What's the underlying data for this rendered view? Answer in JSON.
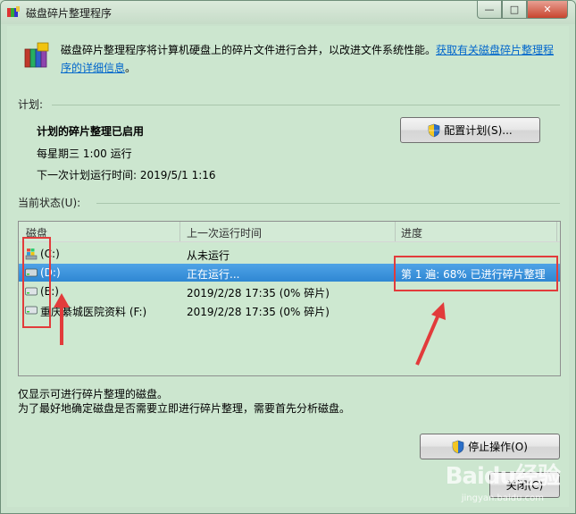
{
  "window": {
    "title": "磁盘碎片整理程序",
    "minimize_glyph": "—",
    "maximize_glyph": "□",
    "close_glyph": "✕"
  },
  "intro": {
    "text": "磁盘碎片整理程序将计算机硬盘上的碎片文件进行合并，以改进文件系统性能。",
    "link": "获取有关磁盘碎片整理程序的详细信息",
    "link_suffix": "。"
  },
  "schedule": {
    "section_label": "计划:",
    "status": "计划的碎片整理已启用",
    "frequency": "每星期三  1:00 运行",
    "next_run": "下一次计划运行时间: 2019/5/1 1:16",
    "configure_button": "配置计划(S)..."
  },
  "current_status": {
    "section_label": "当前状态(U):",
    "columns": [
      "磁盘",
      "上一次运行时间",
      "进度"
    ],
    "rows": [
      {
        "disk": "(C:)",
        "last_run": "从未运行",
        "progress": "",
        "icon": "windows-drive-icon"
      },
      {
        "disk": "(D:)",
        "last_run": "正在运行...",
        "progress": "第 1 遍: 68% 已进行碎片整理",
        "icon": "drive-icon",
        "selected": true
      },
      {
        "disk": "(E:)",
        "last_run": "2019/2/28 17:35 (0% 碎片)",
        "progress": "",
        "icon": "drive-icon"
      },
      {
        "disk": "重庆綦城医院资料 (F:)",
        "last_run": "2019/2/28 17:35 (0% 碎片)",
        "progress": "",
        "icon": "drive-icon"
      }
    ]
  },
  "notes": {
    "line1": "仅显示可进行碎片整理的磁盘。",
    "line2": "为了最好地确定磁盘是否需要立即进行碎片整理，需要首先分析磁盘。"
  },
  "buttons": {
    "stop": "停止操作(O)",
    "close": "关闭(C)"
  },
  "watermark": {
    "brand": "Baidu经验",
    "url": "jingyan.baidu.com"
  },
  "colors": {
    "selection": "#3f95de",
    "annotation": "#e23b3b",
    "link": "#0066cc"
  }
}
